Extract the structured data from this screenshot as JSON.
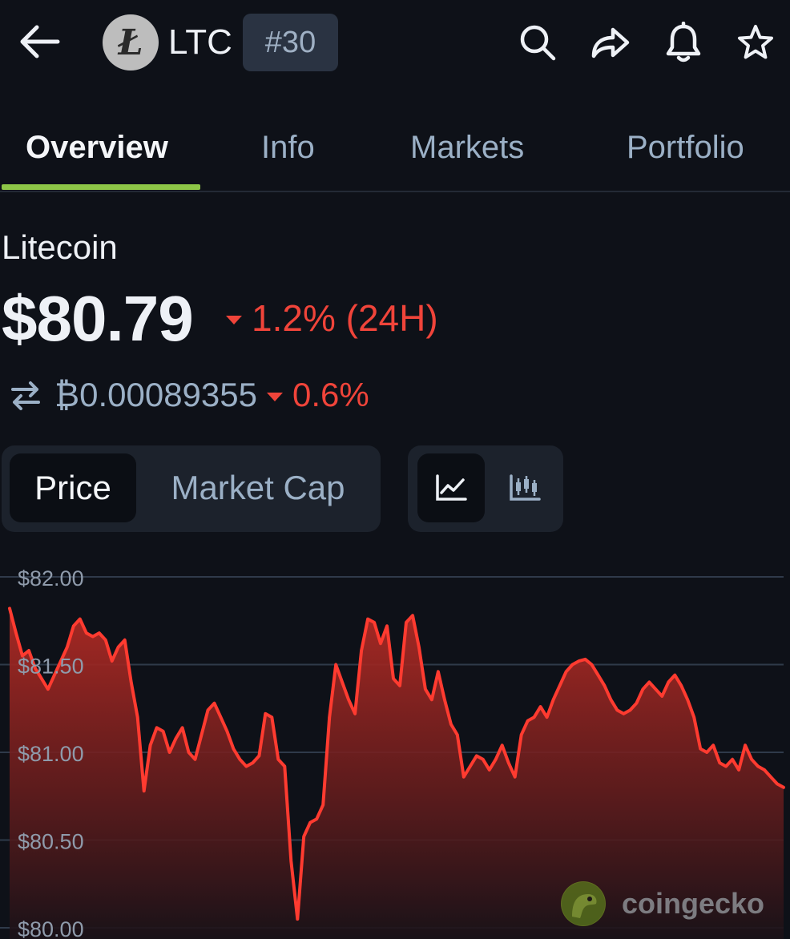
{
  "header": {
    "symbol": "LTC",
    "rank": "#30",
    "logo_letter": "Ł",
    "icons": [
      "back-arrow-icon",
      "search-icon",
      "share-icon",
      "bell-icon",
      "star-icon"
    ]
  },
  "tabs": [
    {
      "label": "Overview",
      "active": true
    },
    {
      "label": "Info",
      "active": false
    },
    {
      "label": "Markets",
      "active": false
    },
    {
      "label": "Portfolio",
      "active": false
    }
  ],
  "coin": {
    "name": "Litecoin",
    "price": "$80.79",
    "change_24h": "1.2% (24H)",
    "btc_price": "₿0.00089355",
    "btc_change": "0.6%"
  },
  "toggles": {
    "metric": [
      "Price",
      "Market Cap"
    ],
    "metric_active": "Price",
    "chart_style_icons": [
      "line-chart-icon",
      "candlestick-chart-icon"
    ]
  },
  "watermark": {
    "text": "coingecko"
  },
  "colors": {
    "background": "#0e1118",
    "accent_green": "#8dc647",
    "negative_red": "#f0443a",
    "muted_text": "#9bb0c6"
  },
  "chart_data": {
    "type": "area",
    "y_ticks": [
      "$82.00",
      "$81.50",
      "$81.00",
      "$80.50",
      "$80.00"
    ],
    "ylim": [
      80.0,
      82.0
    ],
    "grid": true,
    "x": [
      0,
      1,
      2,
      3,
      4,
      5,
      6,
      7,
      8,
      9,
      10,
      11,
      12,
      13,
      14,
      15,
      16,
      17,
      18,
      19,
      20,
      21,
      22,
      23,
      24,
      25,
      26,
      27,
      28,
      29,
      30,
      31,
      32,
      33,
      34,
      35,
      36,
      37,
      38,
      39,
      40,
      41,
      42,
      43,
      44,
      45,
      46,
      47,
      48,
      49,
      50,
      51,
      52,
      53,
      54,
      55,
      56,
      57,
      58,
      59,
      60,
      61,
      62,
      63,
      64,
      65,
      66,
      67,
      68,
      69,
      70,
      71,
      72,
      73,
      74,
      75,
      76,
      77,
      78,
      79,
      80,
      81,
      82,
      83,
      84,
      85,
      86,
      87,
      88,
      89,
      90,
      91,
      92,
      93,
      94,
      95,
      96,
      97,
      98,
      99,
      100,
      101,
      102,
      103,
      104,
      105,
      106,
      107,
      108,
      109,
      110,
      111,
      112,
      113,
      114,
      115,
      116,
      117,
      118,
      119,
      120,
      121
    ],
    "values": [
      81.82,
      81.68,
      81.55,
      81.58,
      81.48,
      81.42,
      81.36,
      81.44,
      81.52,
      81.6,
      81.72,
      81.76,
      81.68,
      81.66,
      81.68,
      81.64,
      81.52,
      81.6,
      81.64,
      81.4,
      81.2,
      80.78,
      81.04,
      81.14,
      81.12,
      81.0,
      81.08,
      81.14,
      81.0,
      80.96,
      81.1,
      81.24,
      81.28,
      81.2,
      81.12,
      81.02,
      80.96,
      80.92,
      80.94,
      80.98,
      81.22,
      81.2,
      80.96,
      80.92,
      80.38,
      80.05,
      80.52,
      80.6,
      80.62,
      80.7,
      81.2,
      81.5,
      81.4,
      81.3,
      81.22,
      81.58,
      81.76,
      81.74,
      81.62,
      81.72,
      81.42,
      81.38,
      81.74,
      81.78,
      81.6,
      81.36,
      81.3,
      81.46,
      81.3,
      81.16,
      81.1,
      80.86,
      80.92,
      80.98,
      80.96,
      80.9,
      80.96,
      81.04,
      80.94,
      80.86,
      81.1,
      81.18,
      81.2,
      81.26,
      81.2,
      81.3,
      81.38,
      81.46,
      81.5,
      81.52,
      81.53,
      81.5,
      81.44,
      81.38,
      81.3,
      81.24,
      81.22,
      81.24,
      81.28,
      81.36,
      81.4,
      81.36,
      81.32,
      81.4,
      81.44,
      81.38,
      81.3,
      81.2,
      81.02,
      81.0,
      81.04,
      80.94,
      80.92,
      80.96,
      80.9,
      81.04,
      80.96,
      80.92,
      80.9,
      80.86,
      80.82,
      80.8
    ]
  }
}
